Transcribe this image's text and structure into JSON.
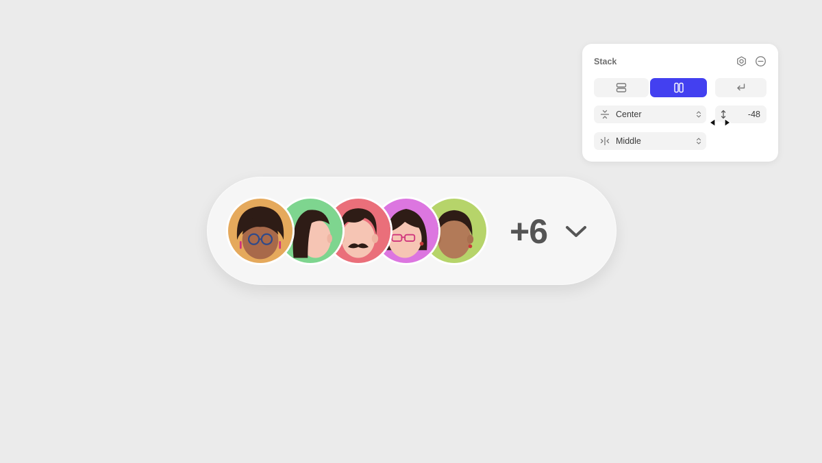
{
  "stack_panel": {
    "title": "Stack",
    "header_icons": [
      "settings-icon",
      "remove-icon"
    ],
    "direction_options": [
      {
        "name": "vertical",
        "icon": "rows-icon",
        "active": false
      },
      {
        "name": "horizontal",
        "icon": "columns-icon",
        "active": true
      },
      {
        "name": "wrap",
        "icon": "wrap-icon",
        "active": false
      }
    ],
    "align": {
      "value": "Center",
      "icon": "align-center-icon"
    },
    "distribute": {
      "value": "Middle",
      "icon": "distribute-middle-icon"
    },
    "gap": {
      "value": "-48",
      "icon": "gap-vertical-icon"
    },
    "colors": {
      "accent": "#4340f0",
      "field_bg": "#f3f3f3",
      "icon": "#7a7a7a"
    }
  },
  "avatar_group": {
    "avatars": [
      {
        "name": "avatar-1",
        "bg": "#e5a95c"
      },
      {
        "name": "avatar-2",
        "bg": "#7ed58f"
      },
      {
        "name": "avatar-3",
        "bg": "#ea6f7a"
      },
      {
        "name": "avatar-4",
        "bg": "#dc76e0"
      },
      {
        "name": "avatar-5",
        "bg": "#b6d46a"
      }
    ],
    "overflow_count": "+6",
    "expand_icon": "chevron-down-icon"
  }
}
